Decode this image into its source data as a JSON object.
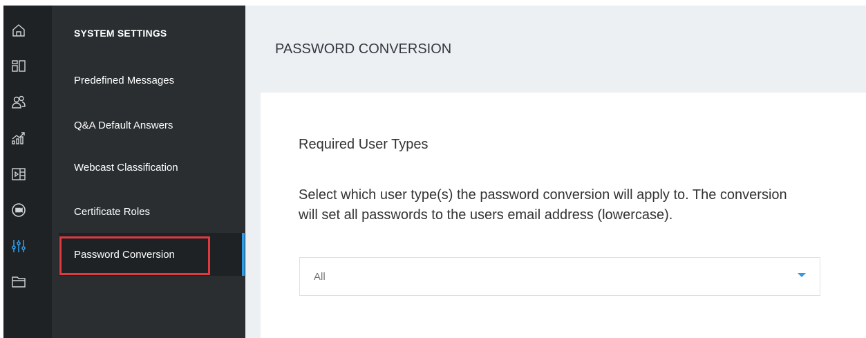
{
  "rail": {
    "icons": [
      "home-icon",
      "dashboard-icon",
      "users-icon",
      "analytics-icon",
      "media-icon",
      "video-icon",
      "settings-sliders-icon",
      "folder-icon"
    ],
    "active_icon": "settings-sliders-icon",
    "icon_color": "#cfd3d6",
    "active_color": "#2f9be5"
  },
  "subnav": {
    "title": "SYSTEM SETTINGS",
    "items": [
      {
        "label": "Predefined Messages"
      },
      {
        "label": "Q&A Default Answers"
      },
      {
        "label": "Webcast Classification"
      },
      {
        "label": "Certificate Roles"
      },
      {
        "label": "Password Conversion",
        "active": true
      }
    ],
    "highlight_color": "#e0393e",
    "accent_color": "#2f9be5"
  },
  "main": {
    "title": "PASSWORD CONVERSION",
    "section_title": "Required User Types",
    "description": "Select which user type(s) the password conversion will apply to. The conversion will set all passwords to the users email address (lowercase).",
    "select": {
      "value": "All"
    }
  }
}
